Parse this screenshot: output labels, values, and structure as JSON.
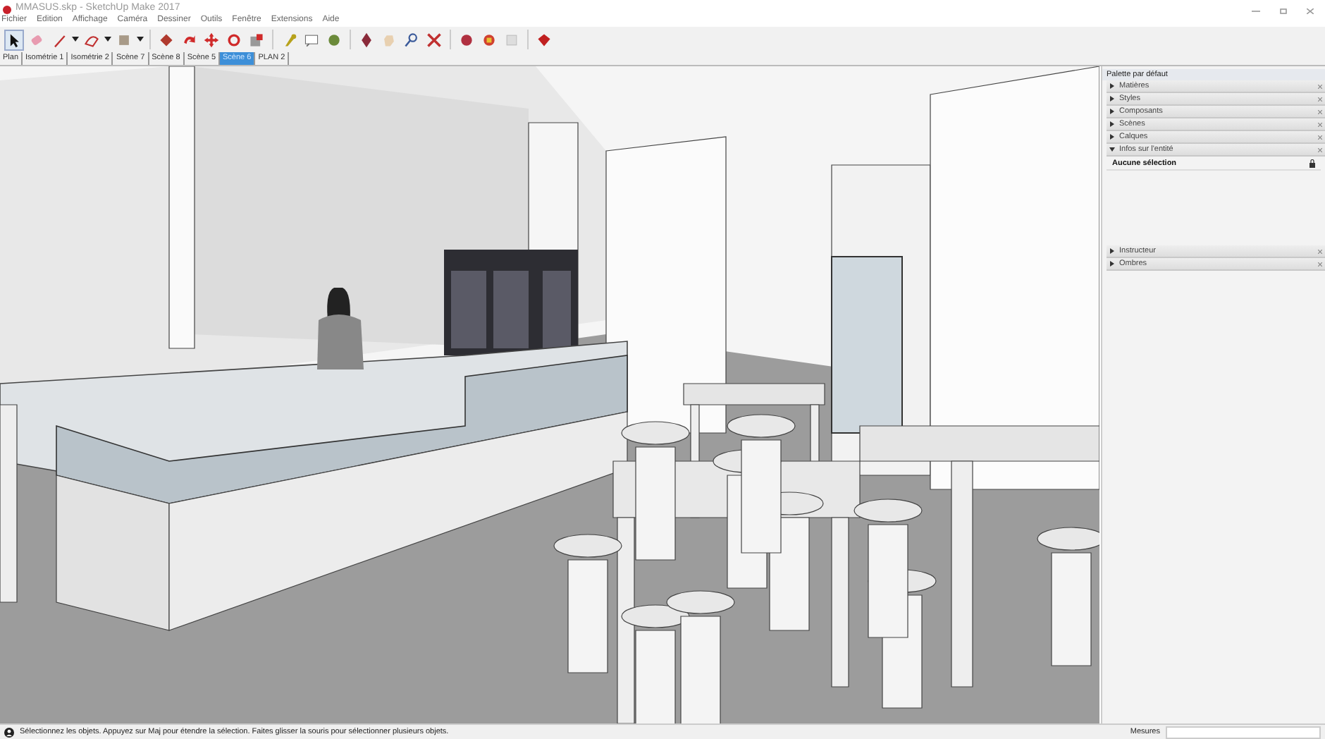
{
  "window": {
    "title": "MMASUS.skp - SketchUp Make 2017"
  },
  "menu": [
    "Fichier",
    "Edition",
    "Affichage",
    "Caméra",
    "Dessiner",
    "Outils",
    "Fenêtre",
    "Extensions",
    "Aide"
  ],
  "scene_tabs": [
    {
      "label": "Plan",
      "selected": false
    },
    {
      "label": "Isométrie 1",
      "selected": false
    },
    {
      "label": "Isométrie 2",
      "selected": false
    },
    {
      "label": "Scène 7",
      "selected": false
    },
    {
      "label": "Scène 8",
      "selected": false
    },
    {
      "label": "Scène 5",
      "selected": false
    },
    {
      "label": "Scène 6",
      "selected": true
    },
    {
      "label": "PLAN 2",
      "selected": false
    }
  ],
  "tray": {
    "title": "Palette par défaut",
    "panels": [
      {
        "label": "Matières",
        "expanded": false
      },
      {
        "label": "Styles",
        "expanded": false
      },
      {
        "label": "Composants",
        "expanded": false
      },
      {
        "label": "Scènes",
        "expanded": false
      },
      {
        "label": "Calques",
        "expanded": false
      },
      {
        "label": "Infos sur l'entité",
        "expanded": true,
        "content": "Aucune sélection"
      }
    ],
    "bottom_panels": [
      {
        "label": "Instructeur",
        "expanded": false
      },
      {
        "label": "Ombres",
        "expanded": false
      }
    ]
  },
  "status_bar": {
    "message": "Sélectionnez les objets. Appuyez sur Maj pour étendre la sélection. Faites glisser la souris pour sélectionner plusieurs objets.",
    "measure_label": "Mesures"
  }
}
